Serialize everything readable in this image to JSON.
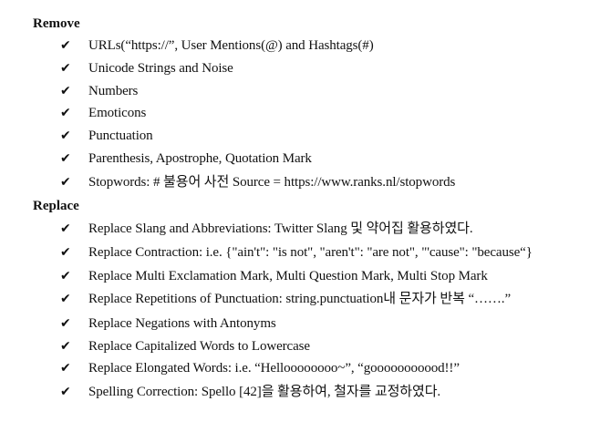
{
  "sections": [
    {
      "title": "Remove",
      "items": [
        "URLs(“https://”, User Mentions(@) and Hashtags(#)",
        "Unicode Strings and Noise",
        "Numbers",
        "Emoticons",
        "Punctuation",
        "Parenthesis, Apostrophe, Quotation Mark",
        "Stopwords: # 불용어 사전  Source = https://www.ranks.nl/stopwords"
      ]
    },
    {
      "title": "Replace",
      "items": [
        "Replace Slang and Abbreviations: Twitter Slang  및  약어집  활용하였다.",
        "Replace Contraction: i.e. {\"ain't\": \"is not\", \"aren't\": \"are not\", \"'cause\": \"because“}",
        "Replace Multi Exclamation Mark, Multi Question Mark, Multi Stop Mark",
        "Replace Repetitions of Punctuation: string.punctuation내  문자가  반복  “…….”",
        "Replace Negations with Antonyms",
        "Replace Capitalized Words to Lowercase",
        "Replace Elongated Words: i.e. “Helloooooooo~”, “gooooooooood!!”",
        "Spelling Correction: Spello [42]을  활용하여,  철자를  교정하였다."
      ]
    }
  ],
  "check_glyph": "✔"
}
